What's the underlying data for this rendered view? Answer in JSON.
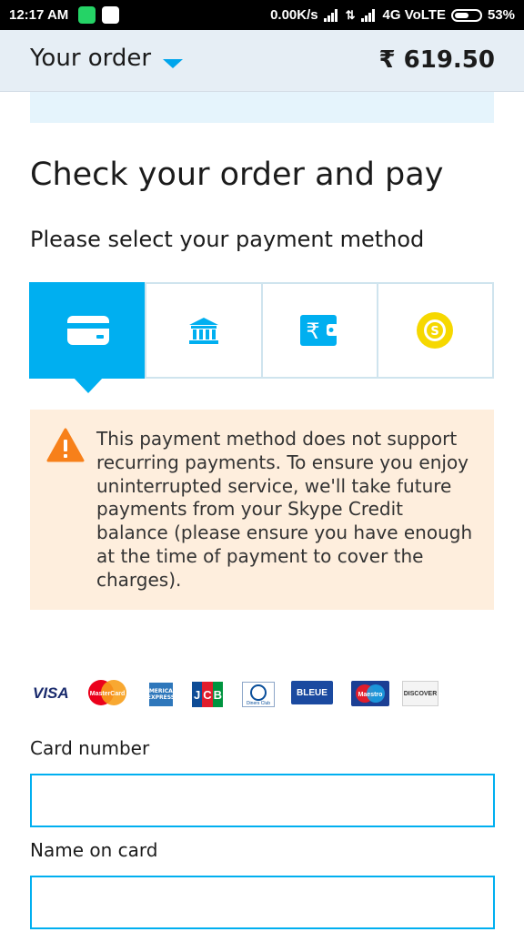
{
  "status_bar": {
    "time": "12:17 AM",
    "network_speed": "0.00K/s",
    "network_type": "4G VoLTE",
    "battery": "53%"
  },
  "header": {
    "title": "Your order",
    "total": "₹ 619.50",
    "caret_icon": "caret-down-icon",
    "accent_color": "#00aff0"
  },
  "main": {
    "title": "Check your order and pay",
    "subtitle": "Please select your payment method",
    "payment_methods": [
      {
        "name": "card",
        "icon": "credit-card-icon",
        "active": true
      },
      {
        "name": "bank",
        "icon": "bank-icon",
        "active": false
      },
      {
        "name": "wallet",
        "icon": "rupee-wallet-icon",
        "active": false
      },
      {
        "name": "credit",
        "icon": "skype-credit-coin-icon",
        "active": false
      }
    ],
    "warning": {
      "icon": "warning-icon",
      "text": "This payment method does not support recurring payments. To ensure you enjoy uninterrupted service, we'll take future payments from your Skype Credit balance (please ensure you have enough at the time of payment to cover the charges).",
      "background": "#feeedd"
    },
    "card_logos": {
      "visa": "VISA",
      "mastercard": "MasterCard",
      "amex": "AMERICAN EXPRESS",
      "jcb": "JCB",
      "diners": "Diners Club",
      "blue": "BLEUE",
      "maestro": "Maestro",
      "discover": "DISCOVER"
    },
    "form": {
      "card_number_label": "Card number",
      "card_number_value": "",
      "name_on_card_label": "Name on card",
      "name_on_card_value": ""
    }
  }
}
